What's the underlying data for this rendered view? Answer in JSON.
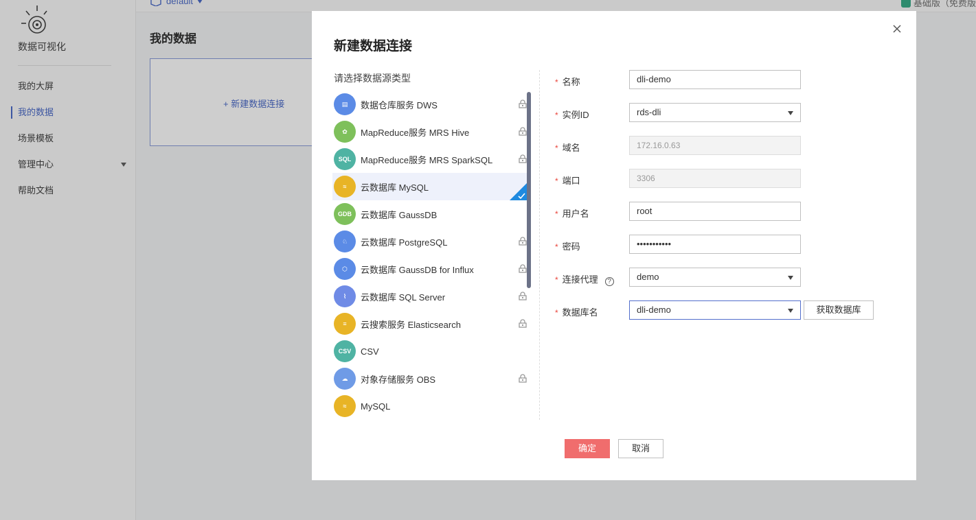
{
  "app": {
    "brand": "数据可视化",
    "project": "default",
    "edition": "基础版（免费版"
  },
  "sidebar": {
    "items": [
      {
        "label": "我的大屏"
      },
      {
        "label": "我的数据"
      },
      {
        "label": "场景模板"
      },
      {
        "label": "管理中心"
      },
      {
        "label": "帮助文档"
      }
    ]
  },
  "main": {
    "title": "我的数据",
    "new_connection": "+ 新建数据连接"
  },
  "modal": {
    "title": "新建数据连接",
    "list_title": "请选择数据源类型",
    "datasources": [
      {
        "label": "数据仓库服务 DWS",
        "icon": "dws-icon",
        "color": "#5b8be6",
        "locked": true
      },
      {
        "label": "MapReduce服务 MRS Hive",
        "icon": "hive-icon",
        "color": "#7ec05b",
        "locked": true
      },
      {
        "label": "MapReduce服务 MRS SparkSQL",
        "icon": "sparksql-icon",
        "color": "#4fb3a3",
        "locked": true
      },
      {
        "label": "云数据库 MySQL",
        "icon": "mysql-icon",
        "color": "#e8b426",
        "locked": false
      },
      {
        "label": "云数据库 GaussDB",
        "icon": "gaussdb-icon",
        "color": "#7ec05b",
        "locked": false
      },
      {
        "label": "云数据库 PostgreSQL",
        "icon": "postgresql-icon",
        "color": "#5b8be6",
        "locked": true
      },
      {
        "label": "云数据库 GaussDB for Influx",
        "icon": "influx-icon",
        "color": "#5b8be6",
        "locked": true
      },
      {
        "label": "云数据库 SQL Server",
        "icon": "sqlserver-icon",
        "color": "#6f8be6",
        "locked": true
      },
      {
        "label": "云搜索服务 Elasticsearch",
        "icon": "elasticsearch-icon",
        "color": "#e8b426",
        "locked": true
      },
      {
        "label": "CSV",
        "icon": "csv-icon",
        "color": "#4fb3a3",
        "locked": false
      },
      {
        "label": "对象存储服务 OBS",
        "icon": "obs-icon",
        "color": "#6f9be6",
        "locked": true
      },
      {
        "label": "MySQL",
        "icon": "mysql-icon",
        "color": "#e8b426",
        "locked": false
      }
    ],
    "selected_index": 3,
    "form": {
      "name_label": "名称",
      "name_value": "dli-demo",
      "instance_label": "实例ID",
      "instance_value": "rds-dli",
      "domain_label": "域名",
      "domain_value": "172.16.0.63",
      "port_label": "端口",
      "port_value": "3306",
      "user_label": "用户名",
      "user_value": "root",
      "password_label": "密码",
      "password_value": "•••••••••••",
      "proxy_label": "连接代理",
      "proxy_value": "demo",
      "dbname_label": "数据库名",
      "dbname_value": "dli-demo",
      "fetch_label": "获取数据库"
    },
    "ok_label": "确定",
    "cancel_label": "取消"
  },
  "colors": {
    "accent": "#3d5fc4",
    "confirm": "#f06d6d",
    "required": "#e9473e"
  }
}
